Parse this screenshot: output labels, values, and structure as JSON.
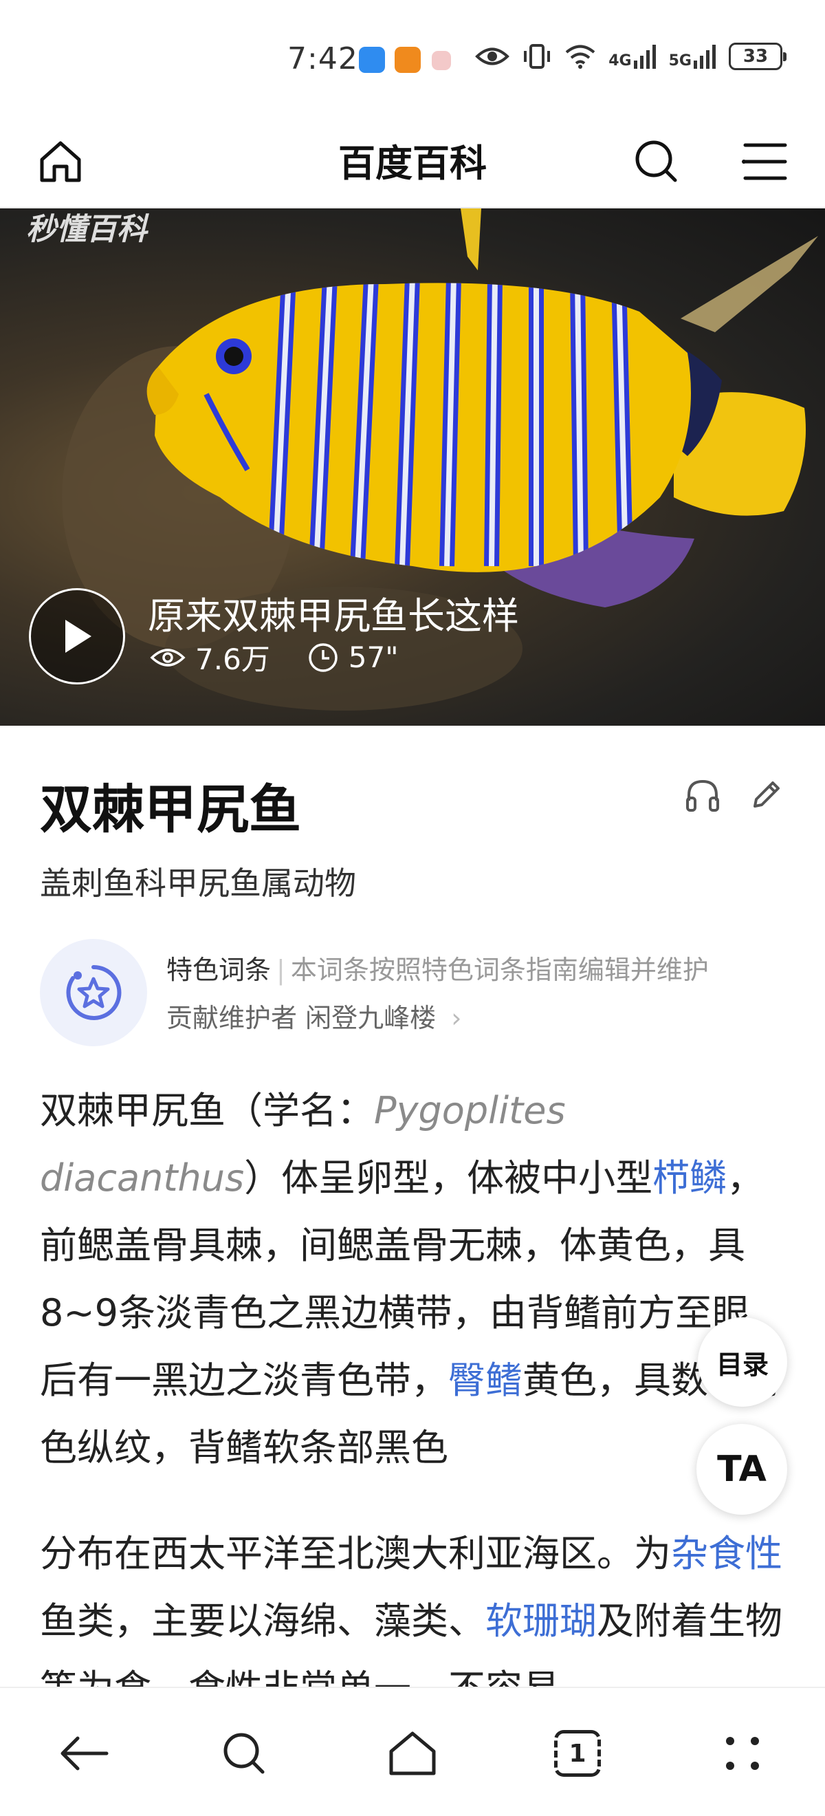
{
  "status_bar": {
    "time": "7:42",
    "network_1": "4G",
    "network_2": "5G",
    "battery": "33"
  },
  "nav": {
    "title": "百度百科"
  },
  "video": {
    "watermark": "秒懂百科",
    "title": "原来双棘甲尻鱼长这样",
    "views": "7.6万",
    "duration": "57\""
  },
  "article": {
    "title": "双棘甲尻鱼",
    "subtitle": "盖刺鱼科甲尻鱼属动物",
    "feature": {
      "label": "特色词条",
      "separator": "|",
      "description": "本词条按照特色词条指南编辑并维护",
      "maintainer_prefix": "贡献维护者",
      "maintainer": "闲登九峰楼",
      "chevron": "›"
    },
    "paragraph1": {
      "t1": "双棘甲尻鱼（学名：",
      "latin": "Pygoplites diacanthus",
      "t2": "）体呈卵型，体被中小型",
      "link1": "栉鳞",
      "t3": "，前鳃盖骨具棘，间鳃盖骨无棘，体黄色，具8~9条淡青色之黑边横带，由背鳍前方至眼后有一黑边之淡青色带，",
      "link2": "臀鳍",
      "t4": "黄色，具数条青色纵纹，背鳍软条部黑色"
    },
    "paragraph2": {
      "t1": "分布在西太平洋至北澳大利亚海区。为",
      "link1": "杂食性",
      "t2": "鱼类，主要以海绵、藻类、",
      "link2": "软珊瑚",
      "t3": "及附着生物等为食，食性非常单一，不容易"
    }
  },
  "floating": {
    "toc_label": "目录",
    "ta_label": "TA"
  },
  "bottom_nav": {
    "tabs_count": "1"
  },
  "colors": {
    "link": "#3d6ed5",
    "fish_yellow": "#f2c200",
    "fish_blue": "#3a3fd8"
  }
}
